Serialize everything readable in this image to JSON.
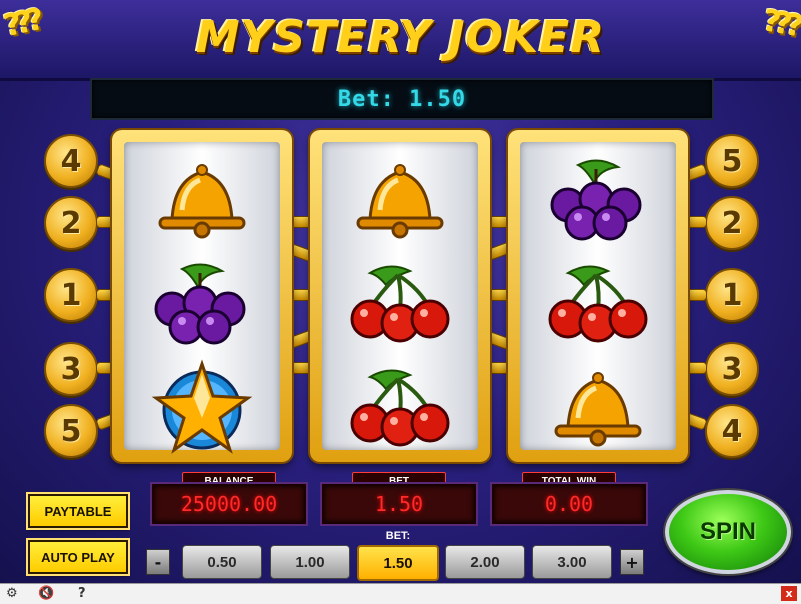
{
  "game": {
    "title": "MYSTERY JOKER",
    "bet_display": "Bet: 1.50"
  },
  "paylines": {
    "left": [
      "4",
      "2",
      "1",
      "3",
      "5"
    ],
    "right": [
      "5",
      "2",
      "1",
      "3",
      "4"
    ]
  },
  "reels": [
    {
      "symbols": [
        "bell",
        "plums",
        "star"
      ]
    },
    {
      "symbols": [
        "bell",
        "cherries",
        "cherries"
      ]
    },
    {
      "symbols": [
        "plums",
        "cherries",
        "bell"
      ]
    }
  ],
  "panels": {
    "balance": {
      "label": "BALANCE",
      "value": "25000.00"
    },
    "bet": {
      "label": "BET",
      "value": "1.50"
    },
    "total_win": {
      "label": "TOTAL WIN",
      "value": "0.00"
    }
  },
  "buttons": {
    "paytable": "PAYTABLE",
    "autoplay": "AUTO PLAY",
    "spin": "SPIN",
    "decrease": "-",
    "increase": "+"
  },
  "bet_selector": {
    "caption": "BET:",
    "options": [
      "0.50",
      "1.00",
      "1.50",
      "2.00",
      "3.00"
    ],
    "selected": "1.50"
  },
  "statusbar": {
    "settings_icon": "gear-icon",
    "sound_icon": "speaker-muted-icon",
    "help": "?",
    "close": "x"
  },
  "colors": {
    "accent": "#ffcf1a",
    "display_text": "#34d8e6",
    "panel_text": "#ff2a2a",
    "spin_green": "#3ec816"
  }
}
